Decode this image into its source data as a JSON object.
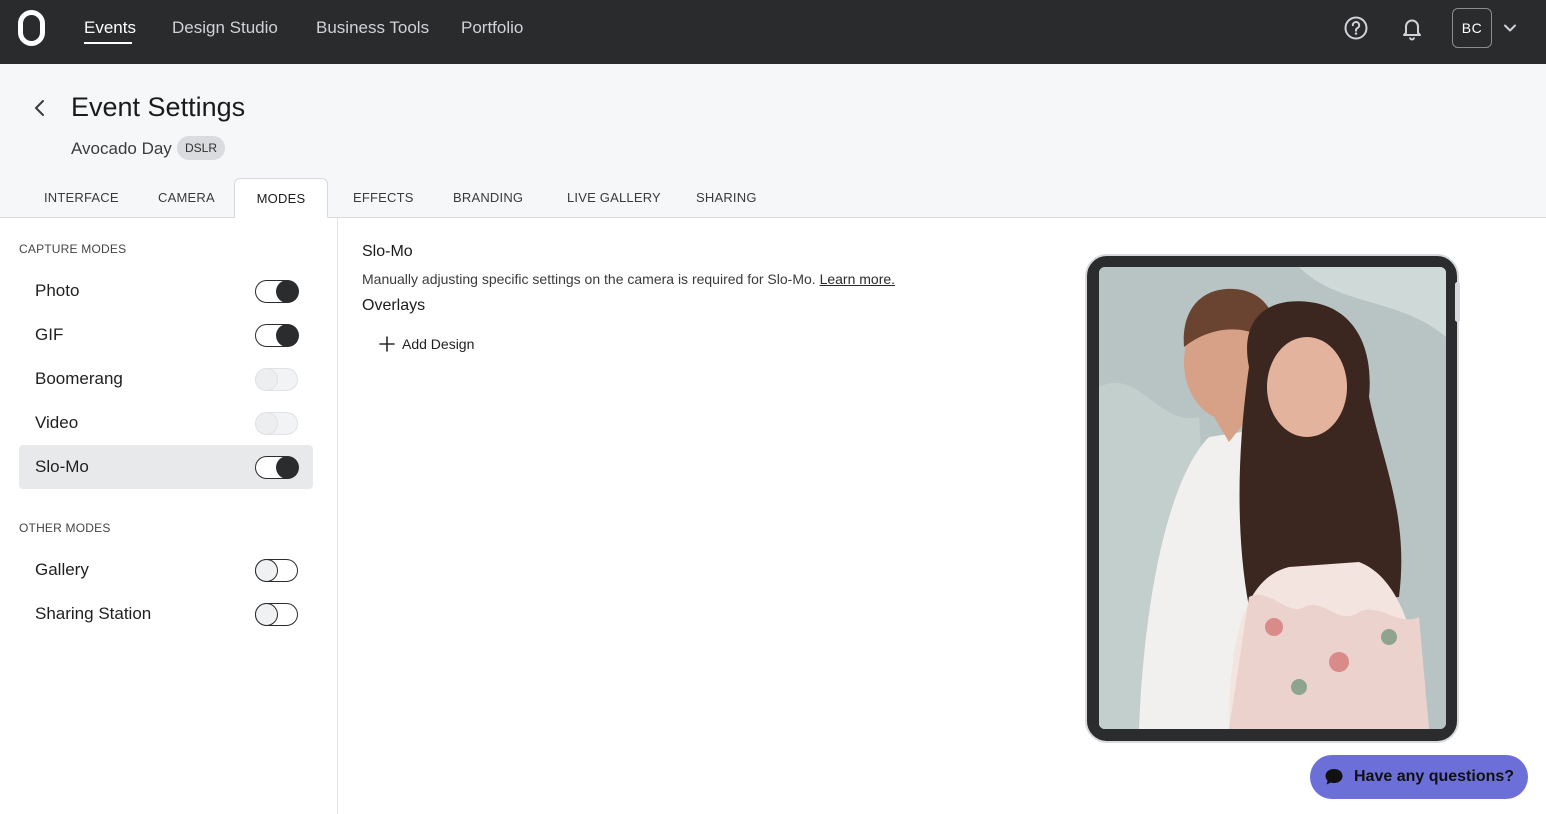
{
  "nav": {
    "items": [
      {
        "label": "Events",
        "active": true
      },
      {
        "label": "Design Studio",
        "active": false
      },
      {
        "label": "Business Tools",
        "active": false
      },
      {
        "label": "Portfolio",
        "active": false
      }
    ],
    "help_icon": "help-circle-icon",
    "bell_icon": "bell-icon",
    "avatar_initials": "BC"
  },
  "header": {
    "title": "Event Settings",
    "event_name": "Avocado Day",
    "badge": "DSLR"
  },
  "tabs": [
    {
      "label": "INTERFACE",
      "active": false
    },
    {
      "label": "CAMERA",
      "active": false
    },
    {
      "label": "MODES",
      "active": true
    },
    {
      "label": "EFFECTS",
      "active": false
    },
    {
      "label": "BRANDING",
      "active": false
    },
    {
      "label": "LIVE GALLERY",
      "active": false
    },
    {
      "label": "SHARING",
      "active": false
    }
  ],
  "sidebar": {
    "capture_label": "CAPTURE MODES",
    "capture_modes": [
      {
        "label": "Photo",
        "state": "on"
      },
      {
        "label": "GIF",
        "state": "on"
      },
      {
        "label": "Boomerang",
        "state": "disabled"
      },
      {
        "label": "Video",
        "state": "disabled"
      },
      {
        "label": "Slo-Mo",
        "state": "on",
        "selected": true
      }
    ],
    "other_label": "OTHER MODES",
    "other_modes": [
      {
        "label": "Gallery",
        "state": "off"
      },
      {
        "label": "Sharing Station",
        "state": "off"
      }
    ]
  },
  "main": {
    "title": "Slo-Mo",
    "description": "Manually adjusting specific settings on the camera is required for Slo-Mo.",
    "learn_more": "Learn more.",
    "overlays_title": "Overlays",
    "add_design": "Add Design"
  },
  "chat": {
    "label": "Have any questions?"
  },
  "colors": {
    "topbar": "#2a2b2d",
    "header_bg": "#f6f7f9",
    "toggle_on": "#2b2c2e",
    "chat_bg": "#6c6fd8"
  }
}
